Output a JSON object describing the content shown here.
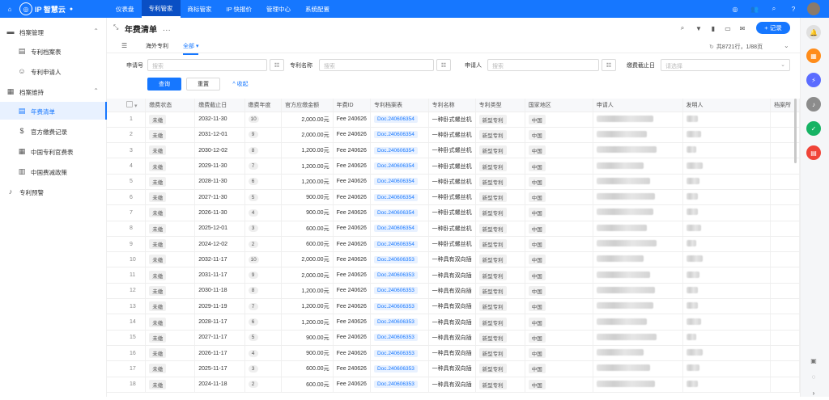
{
  "topbar": {
    "brand": "IP 智慧云",
    "nav": [
      "仪表盘",
      "专利管家",
      "商标管家",
      "IP 快报价",
      "管理中心",
      "系统配置"
    ],
    "active_nav": 1
  },
  "sidebar": {
    "groups": [
      {
        "label": "档案管理",
        "icon": "folder-icon",
        "items": [
          {
            "label": "专利档案表",
            "icon": "file-icon"
          },
          {
            "label": "专利申请人",
            "icon": "user-icon"
          }
        ]
      },
      {
        "label": "档案维持",
        "icon": "archive-icon",
        "items": [
          {
            "label": "年费清单",
            "icon": "calendar-icon",
            "active": true
          },
          {
            "label": "官方缴费记录",
            "icon": "coin-icon"
          },
          {
            "label": "中国专利官费表",
            "icon": "grid-icon"
          },
          {
            "label": "中国费减政策",
            "icon": "building-icon"
          }
        ]
      },
      {
        "label": "专利预警",
        "icon": "bell-icon",
        "items": []
      }
    ]
  },
  "page": {
    "title": "年费清单",
    "title_more": "···",
    "add_button": "+ 记录",
    "tabs": [
      "海外专利",
      "全部"
    ],
    "active_tab": 1,
    "stats": "共8721行，1/88页"
  },
  "filters": [
    {
      "label": "申请号",
      "placeholder": "搜索"
    },
    {
      "label": "专利名称",
      "placeholder": "搜索"
    },
    {
      "label": "申请人",
      "placeholder": "搜索"
    },
    {
      "label": "缴费截止日",
      "placeholder": "请选择"
    }
  ],
  "buttons": {
    "query": "查询",
    "reset": "重置",
    "collapse": "^ 收起"
  },
  "columns": [
    "",
    "缴费状态",
    "缴费截止日",
    "缴费年度",
    "官方应缴金额",
    "年费ID",
    "专利档案表",
    "专利名称",
    "专利类型",
    "国家地区",
    "申请人",
    "发明人",
    "档案所"
  ],
  "rows": [
    {
      "n": "1",
      "status": "未缴",
      "due": "2032-11-30",
      "year": "10",
      "amount": "2,000.00元",
      "fee": "Fee 240626",
      "doc": "Doc.240606354",
      "name": "一种卧式螺丝机",
      "type": "新型专利",
      "region": "中国"
    },
    {
      "n": "2",
      "status": "未缴",
      "due": "2031-12-01",
      "year": "9",
      "amount": "2,000.00元",
      "fee": "Fee 240626",
      "doc": "Doc.240606354",
      "name": "一种卧式螺丝机",
      "type": "新型专利",
      "region": "中国"
    },
    {
      "n": "3",
      "status": "未缴",
      "due": "2030-12-02",
      "year": "8",
      "amount": "1,200.00元",
      "fee": "Fee 240626",
      "doc": "Doc.240606354",
      "name": "一种卧式螺丝机",
      "type": "新型专利",
      "region": "中国"
    },
    {
      "n": "4",
      "status": "未缴",
      "due": "2029-11-30",
      "year": "7",
      "amount": "1,200.00元",
      "fee": "Fee 240626",
      "doc": "Doc.240606354",
      "name": "一种卧式螺丝机",
      "type": "新型专利",
      "region": "中国"
    },
    {
      "n": "5",
      "status": "未缴",
      "due": "2028-11-30",
      "year": "6",
      "amount": "1,200.00元",
      "fee": "Fee 240626",
      "doc": "Doc.240606354",
      "name": "一种卧式螺丝机",
      "type": "新型专利",
      "region": "中国"
    },
    {
      "n": "6",
      "status": "未缴",
      "due": "2027-11-30",
      "year": "5",
      "amount": "900.00元",
      "fee": "Fee 240626",
      "doc": "Doc.240606354",
      "name": "一种卧式螺丝机",
      "type": "新型专利",
      "region": "中国"
    },
    {
      "n": "7",
      "status": "未缴",
      "due": "2026-11-30",
      "year": "4",
      "amount": "900.00元",
      "fee": "Fee 240626",
      "doc": "Doc.240606354",
      "name": "一种卧式螺丝机",
      "type": "新型专利",
      "region": "中国"
    },
    {
      "n": "8",
      "status": "未缴",
      "due": "2025-12-01",
      "year": "3",
      "amount": "600.00元",
      "fee": "Fee 240626",
      "doc": "Doc.240606354",
      "name": "一种卧式螺丝机",
      "type": "新型专利",
      "region": "中国"
    },
    {
      "n": "9",
      "status": "未缴",
      "due": "2024-12-02",
      "year": "2",
      "amount": "600.00元",
      "fee": "Fee 240626",
      "doc": "Doc.240606354",
      "name": "一种卧式螺丝机",
      "type": "新型专利",
      "region": "中国"
    },
    {
      "n": "10",
      "status": "未缴",
      "due": "2032-11-17",
      "year": "10",
      "amount": "2,000.00元",
      "fee": "Fee 240626",
      "doc": "Doc.240606353",
      "name": "一种具有双向插",
      "type": "新型专利",
      "region": "中国"
    },
    {
      "n": "11",
      "status": "未缴",
      "due": "2031-11-17",
      "year": "9",
      "amount": "2,000.00元",
      "fee": "Fee 240626",
      "doc": "Doc.240606353",
      "name": "一种具有双向插",
      "type": "新型专利",
      "region": "中国"
    },
    {
      "n": "12",
      "status": "未缴",
      "due": "2030-11-18",
      "year": "8",
      "amount": "1,200.00元",
      "fee": "Fee 240626",
      "doc": "Doc.240606353",
      "name": "一种具有双向插",
      "type": "新型专利",
      "region": "中国"
    },
    {
      "n": "13",
      "status": "未缴",
      "due": "2029-11-19",
      "year": "7",
      "amount": "1,200.00元",
      "fee": "Fee 240626",
      "doc": "Doc.240606353",
      "name": "一种具有双向插",
      "type": "新型专利",
      "region": "中国"
    },
    {
      "n": "14",
      "status": "未缴",
      "due": "2028-11-17",
      "year": "6",
      "amount": "1,200.00元",
      "fee": "Fee 240626",
      "doc": "Doc.240606353",
      "name": "一种具有双向插",
      "type": "新型专利",
      "region": "中国"
    },
    {
      "n": "15",
      "status": "未缴",
      "due": "2027-11-17",
      "year": "5",
      "amount": "900.00元",
      "fee": "Fee 240626",
      "doc": "Doc.240606353",
      "name": "一种具有双向插",
      "type": "新型专利",
      "region": "中国"
    },
    {
      "n": "16",
      "status": "未缴",
      "due": "2026-11-17",
      "year": "4",
      "amount": "900.00元",
      "fee": "Fee 240626",
      "doc": "Doc.240606353",
      "name": "一种具有双向插",
      "type": "新型专利",
      "region": "中国"
    },
    {
      "n": "17",
      "status": "未缴",
      "due": "2025-11-17",
      "year": "3",
      "amount": "600.00元",
      "fee": "Fee 240626",
      "doc": "Doc.240606353",
      "name": "一种具有双向插",
      "type": "新型专利",
      "region": "中国"
    },
    {
      "n": "18",
      "status": "未缴",
      "due": "2024-11-18",
      "year": "2",
      "amount": "600.00元",
      "fee": "Fee 240626",
      "doc": "Doc.240606353",
      "name": "一种具有双向插",
      "type": "新型专利",
      "region": "中国"
    }
  ],
  "colors": {
    "accent": "#1677ff",
    "rightbar": [
      "#ff8c1a",
      "#5b6cff",
      "#8c8c8c",
      "#16b364",
      "#f04438"
    ]
  }
}
